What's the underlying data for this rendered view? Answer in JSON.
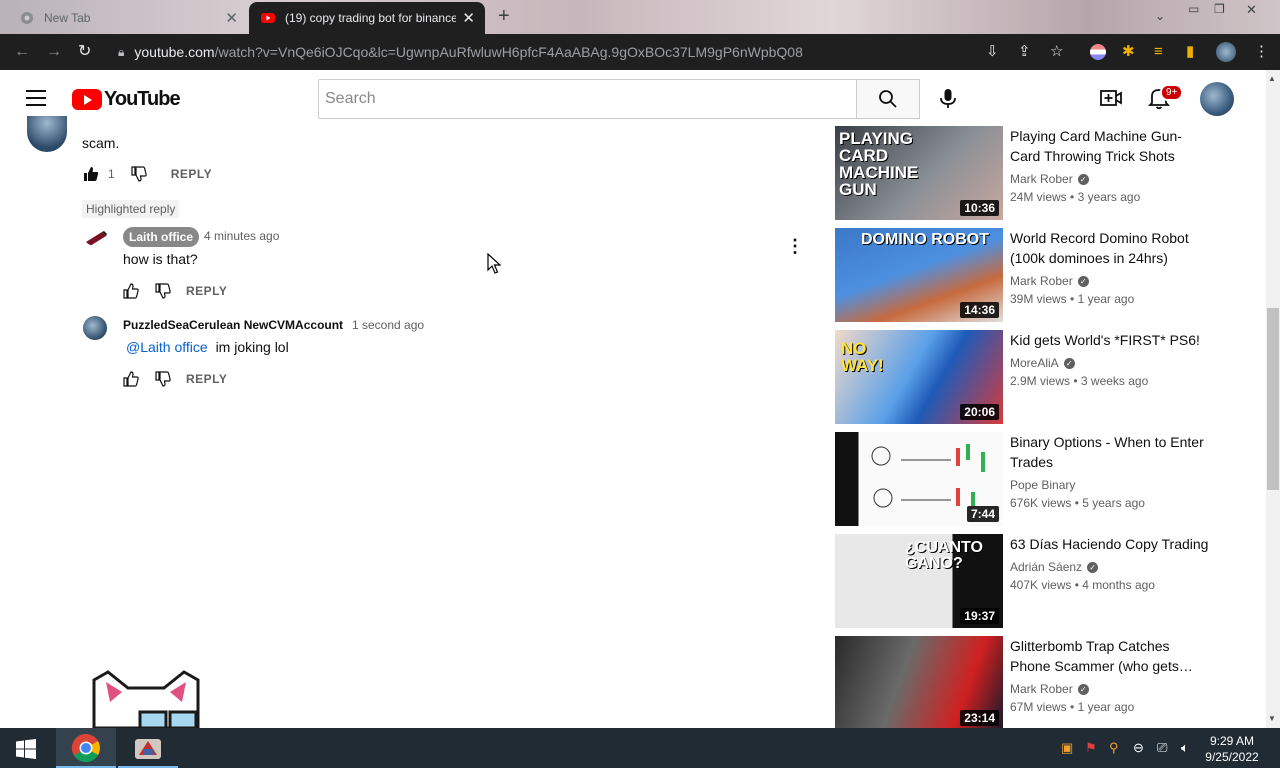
{
  "browser": {
    "tabs": [
      {
        "title": "New Tab",
        "active": false
      },
      {
        "title": "(19) copy trading bot for binance",
        "active": true
      }
    ],
    "new_tab_symbol": "+",
    "url_domain": "youtube.com",
    "url_rest": "/watch?v=VnQe6iOJCqo&lc=UgwnpAuRfwluwH6pfcF4AaABAg.9gOxBOc37LM9gP6nWpbQ08"
  },
  "header": {
    "logo_text": "YouTube",
    "search_placeholder": "Search",
    "notification_count": "9+"
  },
  "comments": {
    "top_comment_text": "scam.",
    "top_comment_likes": "1",
    "reply_label": "REPLY",
    "highlighted_label": "Highlighted reply",
    "replies": [
      {
        "author": "Laith office",
        "time": "4 minutes ago",
        "text": "how is that?",
        "highlighted": true
      },
      {
        "author": "PuzzledSeaCerulean NewCVMAccount",
        "time": "1 second ago",
        "mention": "@Laith office",
        "text": "im joking lol",
        "highlighted": false
      }
    ]
  },
  "recommendations": [
    {
      "title": "Playing Card Machine Gun- Card Throwing Trick Shots",
      "channel": "Mark Rober",
      "verified": true,
      "views": "24M views",
      "age": "3 years ago",
      "duration": "10:36",
      "thumb_text": "PLAYING CARD MACHINE GUN"
    },
    {
      "title": "World Record Domino Robot (100k dominoes in 24hrs)",
      "channel": "Mark Rober",
      "verified": true,
      "views": "39M views",
      "age": "1 year ago",
      "duration": "14:36",
      "thumb_text": "DOMINO ROBOT"
    },
    {
      "title": "Kid gets World's *FIRST* PS6!",
      "channel": "MoreAliA",
      "verified": true,
      "views": "2.9M views",
      "age": "3 weeks ago",
      "duration": "20:06",
      "thumb_text": "NO WAY!"
    },
    {
      "title": "Binary Options - When to Enter Trades",
      "channel": "Pope Binary",
      "verified": false,
      "views": "676K views",
      "age": "5 years ago",
      "duration": "7:44",
      "thumb_text": ""
    },
    {
      "title": "63 Días Haciendo Copy Trading",
      "channel": "Adrián Sáenz",
      "verified": true,
      "views": "407K views",
      "age": "4 months ago",
      "duration": "19:37",
      "thumb_text": "¿CUANTO GANO?"
    },
    {
      "title": "Glitterbomb Trap Catches Phone Scammer (who gets…",
      "channel": "Mark Rober",
      "verified": true,
      "views": "67M views",
      "age": "1 year ago",
      "duration": "23:14",
      "thumb_text": ""
    }
  ],
  "taskbar": {
    "time": "9:29 AM",
    "date": "9/25/2022"
  },
  "colors": {
    "youtube_red": "#ff0000",
    "link_blue": "#065fd4",
    "taskbar": "#202b33"
  }
}
